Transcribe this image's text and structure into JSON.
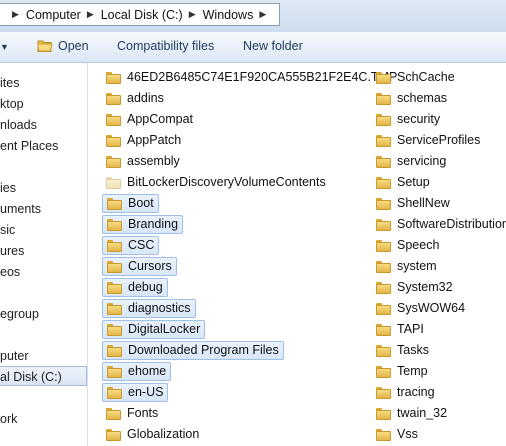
{
  "address": {
    "crumbs": [
      "Computer",
      "Local Disk (C:)",
      "Windows"
    ]
  },
  "toolbar": {
    "open_label": "Open",
    "compat_label": "Compatibility files",
    "newfolder_label": "New folder"
  },
  "nav": {
    "items": [
      "ites",
      "ktop",
      "nloads",
      "ent Places",
      "ies",
      "uments",
      "sic",
      "ures",
      "eos",
      "egroup",
      "puter",
      "al Disk (C:)",
      "ork"
    ],
    "selected_index": 11
  },
  "files": {
    "col1": [
      {
        "name": "46ED2B6485C74E1F920CA555B21F2E4C.TMP",
        "selected": false,
        "dim": false
      },
      {
        "name": "addins",
        "selected": false,
        "dim": false
      },
      {
        "name": "AppCompat",
        "selected": false,
        "dim": false
      },
      {
        "name": "AppPatch",
        "selected": false,
        "dim": false
      },
      {
        "name": "assembly",
        "selected": false,
        "dim": false
      },
      {
        "name": "BitLockerDiscoveryVolumeContents",
        "selected": false,
        "dim": true
      },
      {
        "name": "Boot",
        "selected": true,
        "dim": false
      },
      {
        "name": "Branding",
        "selected": true,
        "dim": false
      },
      {
        "name": "CSC",
        "selected": true,
        "dim": false
      },
      {
        "name": "Cursors",
        "selected": true,
        "dim": false
      },
      {
        "name": "debug",
        "selected": true,
        "dim": false
      },
      {
        "name": "diagnostics",
        "selected": true,
        "dim": false
      },
      {
        "name": "DigitalLocker",
        "selected": true,
        "dim": false
      },
      {
        "name": "Downloaded Program Files",
        "selected": true,
        "dim": false
      },
      {
        "name": "ehome",
        "selected": true,
        "dim": false
      },
      {
        "name": "en-US",
        "selected": true,
        "dim": false
      },
      {
        "name": "Fonts",
        "selected": false,
        "dim": false
      },
      {
        "name": "Globalization",
        "selected": false,
        "dim": false
      }
    ],
    "col2": [
      {
        "name": "SchCache"
      },
      {
        "name": "schemas"
      },
      {
        "name": "security"
      },
      {
        "name": "ServiceProfiles"
      },
      {
        "name": "servicing"
      },
      {
        "name": "Setup"
      },
      {
        "name": "ShellNew"
      },
      {
        "name": "SoftwareDistribution"
      },
      {
        "name": "Speech"
      },
      {
        "name": "system"
      },
      {
        "name": "System32"
      },
      {
        "name": "SysWOW64"
      },
      {
        "name": "TAPI"
      },
      {
        "name": "Tasks"
      },
      {
        "name": "Temp"
      },
      {
        "name": "tracing"
      },
      {
        "name": "twain_32"
      },
      {
        "name": "Vss"
      }
    ]
  },
  "colors": {
    "selection_border": "#9ebfe6",
    "toolbar_text": "#1e395b",
    "folder_fill": "#f0c960"
  }
}
